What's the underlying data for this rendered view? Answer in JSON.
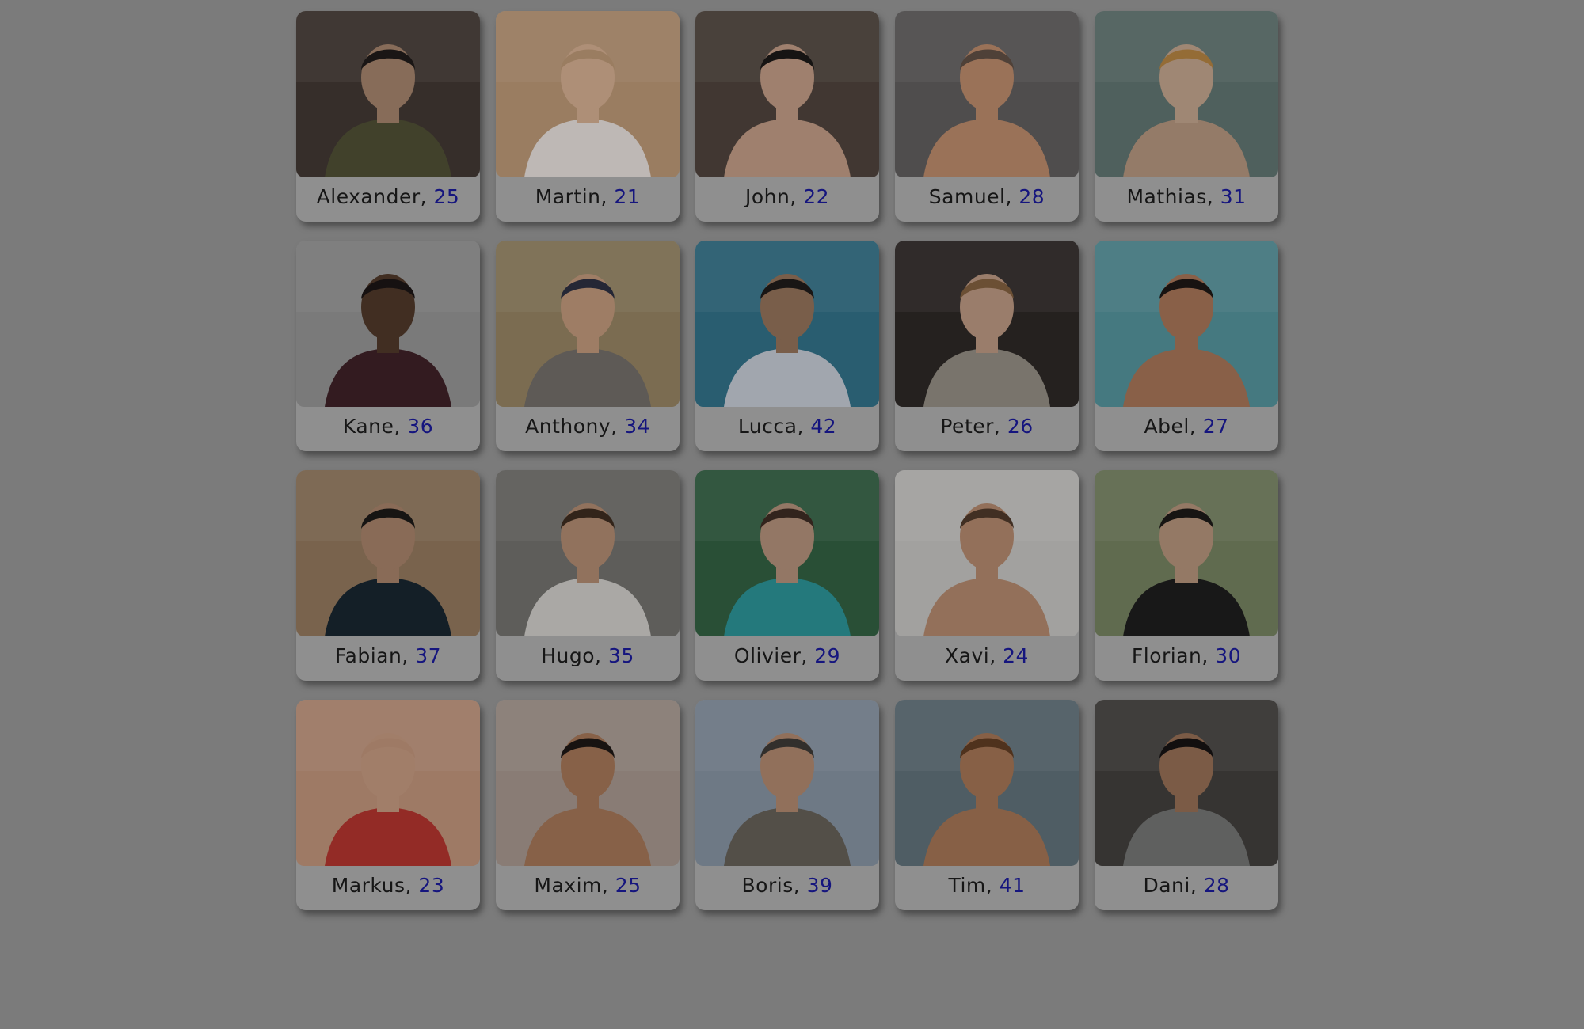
{
  "profiles": [
    {
      "name": "Alexander",
      "sep": ", ",
      "age": "25",
      "bg": "#3e3530",
      "skin": "#9a7b66",
      "shirt": "#4a4a32",
      "hair": "#1e1a18"
    },
    {
      "name": "Martin",
      "sep": ", ",
      "age": "21",
      "bg": "#b08f6f",
      "skin": "#c7a388",
      "shirt": "#d9d2cf",
      "hair": "#b08f6f"
    },
    {
      "name": "John",
      "sep": ", ",
      "age": "22",
      "bg": "#4a3f39",
      "skin": "#b5927e",
      "shirt": "#b5927e",
      "hair": "#1a1716"
    },
    {
      "name": "Samuel",
      "sep": ", ",
      "age": "28",
      "bg": "#5a5858",
      "skin": "#b08265",
      "shirt": "#b08265",
      "hair": "#5a4a40"
    },
    {
      "name": "Mathias",
      "sep": ", ",
      "age": "31",
      "bg": "#5b6e6a",
      "skin": "#b69a84",
      "shirt": "#a98c77",
      "hair": "#a97c3e"
    },
    {
      "name": "Kane",
      "sep": ", ",
      "age": "36",
      "bg": "#8b8b8b",
      "skin": "#4b3527",
      "shirt": "#3b1f25",
      "hair": "#1a1414"
    },
    {
      "name": "Anthony",
      "sep": ", ",
      "age": "34",
      "bg": "#8c7c5d",
      "skin": "#b48f74",
      "shirt": "#6c6762",
      "hair": "#2b2d3d"
    },
    {
      "name": "Lucca",
      "sep": ", ",
      "age": "42",
      "bg": "#2f6a80",
      "skin": "#8a6b55",
      "shirt": "#b8bdc7",
      "hair": "#1d1a18"
    },
    {
      "name": "Peter",
      "sep": ", ",
      "age": "26",
      "bg": "#2b2624",
      "skin": "#b08f7a",
      "shirt": "#8a857b",
      "hair": "#7a5a3c"
    },
    {
      "name": "Abel",
      "sep": ", ",
      "age": "27",
      "bg": "#4f8a92",
      "skin": "#9c6e52",
      "shirt": "#9c6e52",
      "hair": "#1c1614"
    },
    {
      "name": "Fabian",
      "sep": ", ",
      "age": "37",
      "bg": "#8a7158",
      "skin": "#9d7a63",
      "shirt": "#17242d",
      "hair": "#1b1816"
    },
    {
      "name": "Hugo",
      "sep": ", ",
      "age": "35",
      "bg": "#6b6a67",
      "skin": "#a6826a",
      "shirt": "#c2c0bc",
      "hair": "#3a2a1e"
    },
    {
      "name": "Olivier",
      "sep": ", ",
      "age": "29",
      "bg": "#2f5b3e",
      "skin": "#a88873",
      "shirt": "#2a8a8e",
      "hair": "#3a2a22"
    },
    {
      "name": "Xavi",
      "sep": ", ",
      "age": "24",
      "bg": "#b9b8b6",
      "skin": "#a88067",
      "shirt": "#a88067",
      "hair": "#4a3628"
    },
    {
      "name": "Florian",
      "sep": ", ",
      "age": "30",
      "bg": "#6e7a5a",
      "skin": "#a98a74",
      "shirt": "#1c1c1c",
      "hair": "#1b1816"
    },
    {
      "name": "Markus",
      "sep": ", ",
      "age": "23",
      "bg": "#b48b74",
      "skin": "#b89078",
      "shirt": "#a8322c",
      "hair": "#b48b74"
    },
    {
      "name": "Maxim",
      "sep": ", ",
      "age": "25",
      "bg": "#9c8e86",
      "skin": "#9a6f52",
      "shirt": "#9a6f52",
      "hair": "#1c1614"
    },
    {
      "name": "Boris",
      "sep": ", ",
      "age": "39",
      "bg": "#7e8a98",
      "skin": "#a58068",
      "shirt": "#5f5a52",
      "hair": "#3a3633"
    },
    {
      "name": "Tim",
      "sep": ", ",
      "age": "41",
      "bg": "#5a6a72",
      "skin": "#9a6e50",
      "shirt": "#9a6e50",
      "hair": "#5b3a22"
    },
    {
      "name": "Dani",
      "sep": ", ",
      "age": "28",
      "bg": "#3e3c3a",
      "skin": "#8c6850",
      "shirt": "#6d6e6d",
      "hair": "#151212"
    }
  ]
}
